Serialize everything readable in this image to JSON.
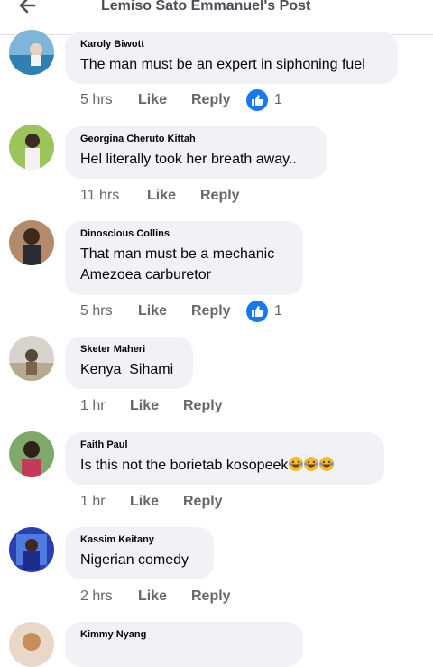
{
  "header": {
    "title": "Lemiso Sato Emmanuel's Post"
  },
  "comments": [
    {
      "author": "Karoly Biwott",
      "text": "The man must be an expert in siphoning fuel",
      "time": "5 hrs",
      "like": "Like",
      "reply": "Reply",
      "reaction_count": "1",
      "reaction": "like-icon"
    },
    {
      "author": "Georgina Cheruto Kittah",
      "text": "Hel literally took her breath away..",
      "time": "11 hrs",
      "like": "Like",
      "reply": "Reply"
    },
    {
      "author": "Dinoscious Collins",
      "text": "That man must be a mechanic\nAmezoea carburetor",
      "time": "5 hrs",
      "like": "Like",
      "reply": "Reply",
      "reaction_count": "1",
      "reaction": "like-icon"
    },
    {
      "author": "Sketer Maheri",
      "text": "Kenya  Sihami",
      "time": "1 hr",
      "like": "Like",
      "reply": "Reply"
    },
    {
      "author": "Faith Paul",
      "text": "Is this not the borietab kosopeek",
      "emoji": [
        "laughing-crying-emoji",
        "laughing-crying-emoji",
        "laughing-crying-emoji"
      ],
      "time": "1 hr",
      "like": "Like",
      "reply": "Reply"
    },
    {
      "author": "Kassim Keitany",
      "text": "Nigerian comedy",
      "time": "2 hrs",
      "like": "Like",
      "reply": "Reply"
    },
    {
      "author": "Kimmy Nyang",
      "text": ""
    }
  ],
  "colors": {
    "like_blue": "#1877f2",
    "bubble": "#f0f2f5",
    "meta_grey": "#65676b"
  }
}
